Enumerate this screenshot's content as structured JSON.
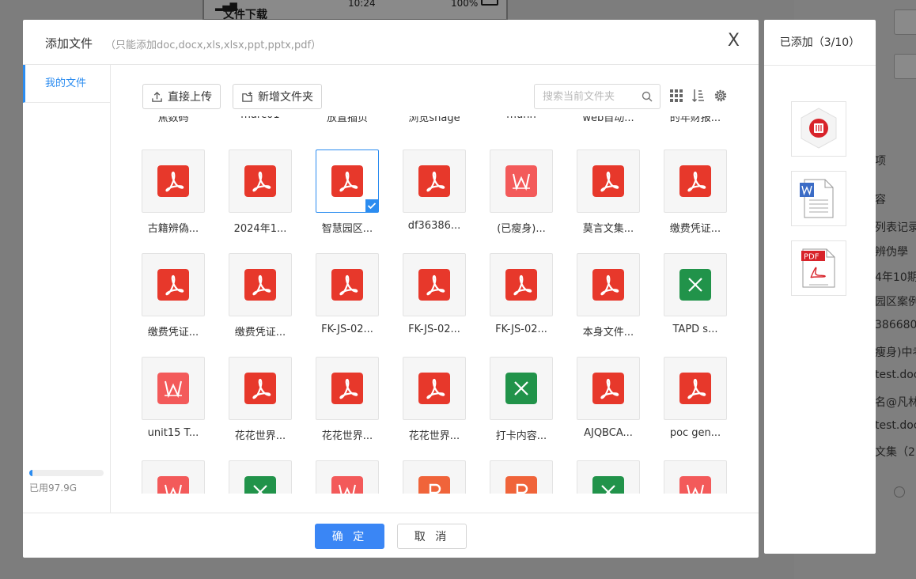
{
  "background": {
    "phone_title": "文件下载",
    "phone_time": "10:24",
    "phone_battery": "100%",
    "right_texts": [
      "项",
      "容",
      "列表记录",
      "辨伪學",
      "4年10期",
      "园区案例",
      "386680",
      "瘦身)中考",
      "test.doc",
      "名@凡林",
      "test.doc",
      "文集（2"
    ]
  },
  "dialog": {
    "title": "添加文件",
    "hint": "（只能添加doc,docx,xls,xlsx,ppt,pptx,pdf）",
    "close": "X"
  },
  "sidebar": {
    "my_files": "我的文件",
    "storage_used": "已用97.9G",
    "storage_fraction": 0.04
  },
  "toolbar": {
    "upload_label": "直接上传",
    "new_folder_label": "新增文件夹",
    "search_placeholder": "搜索当前文件夹"
  },
  "partial_top_names": [
    "焦数码",
    "marc01",
    "放置插页",
    "浏览snage",
    "muhn",
    "web自动...",
    "的年财报..."
  ],
  "files": [
    {
      "name": "古籍辨偽...",
      "type": "pdf",
      "selected": false
    },
    {
      "name": "2024年1...",
      "type": "pdf",
      "selected": false
    },
    {
      "name": "智慧园区...",
      "type": "pdf",
      "selected": true
    },
    {
      "name": "df36386...",
      "type": "pdf",
      "selected": false
    },
    {
      "name": "(已瘦身)...",
      "type": "word",
      "selected": false
    },
    {
      "name": "莫言文集...",
      "type": "pdf",
      "selected": false
    },
    {
      "name": "缴费凭证...",
      "type": "pdf",
      "selected": false
    },
    {
      "name": "缴费凭证...",
      "type": "pdf",
      "selected": false
    },
    {
      "name": "缴费凭证...",
      "type": "pdf",
      "selected": false
    },
    {
      "name": "FK-JS-02...",
      "type": "pdf",
      "selected": false
    },
    {
      "name": "FK-JS-02...",
      "type": "pdf",
      "selected": false
    },
    {
      "name": "FK-JS-02...",
      "type": "pdf",
      "selected": false
    },
    {
      "name": "本身文件...",
      "type": "pdf",
      "selected": false
    },
    {
      "name": "TAPD   s...",
      "type": "excel",
      "selected": false
    },
    {
      "name": "unit15 T...",
      "type": "word",
      "selected": false
    },
    {
      "name": "花花世界...",
      "type": "pdf",
      "selected": false
    },
    {
      "name": "花花世界...",
      "type": "pdf",
      "selected": false
    },
    {
      "name": "花花世界...",
      "type": "pdf",
      "selected": false
    },
    {
      "name": "打卡内容...",
      "type": "excel",
      "selected": false
    },
    {
      "name": "AJQBCA...",
      "type": "pdf",
      "selected": false
    },
    {
      "name": "poc  gen...",
      "type": "pdf",
      "selected": false
    },
    {
      "name": "",
      "type": "word",
      "selected": false
    },
    {
      "name": "",
      "type": "excel",
      "selected": false
    },
    {
      "name": "",
      "type": "word",
      "selected": false
    },
    {
      "name": "",
      "type": "ppt",
      "selected": false
    },
    {
      "name": "",
      "type": "ppt",
      "selected": false
    },
    {
      "name": "",
      "type": "excel",
      "selected": false
    },
    {
      "name": "",
      "type": "word",
      "selected": false
    }
  ],
  "footer": {
    "ok_label": "确 定",
    "cancel_label": "取 消"
  },
  "added_panel": {
    "title": "已添加（3/10）",
    "pdf_badge": "PDF"
  },
  "colors": {
    "accent": "#2b8cf0",
    "pdf": "#e7382b",
    "word": "#f35a5a",
    "excel": "#21934a",
    "ppt": "#f0643a"
  }
}
